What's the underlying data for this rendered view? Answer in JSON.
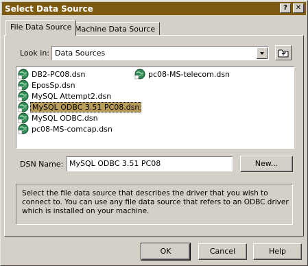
{
  "window": {
    "title": "Select Data Source",
    "help_glyph": "?",
    "close_glyph": "✕"
  },
  "tabs": [
    {
      "label": "File Data Source",
      "active": true
    },
    {
      "label": "Machine Data Source",
      "active": false
    }
  ],
  "look_in": {
    "label": "Look in:",
    "value": "Data Sources"
  },
  "files": [
    {
      "name": "DB2-PC08.dsn"
    },
    {
      "name": "EposSp.dsn"
    },
    {
      "name": "MySQL Attempt2.dsn"
    },
    {
      "name": "MySQL ODBC 3.51 PC08.dsn",
      "selected": true
    },
    {
      "name": "MySQL ODBC.dsn"
    },
    {
      "name": "pc08-MS-comcap.dsn"
    },
    {
      "name": "pc08-MS-telecom.dsn"
    }
  ],
  "dsn": {
    "label": "DSN Name:",
    "value": "MySQL ODBC 3.51 PC08",
    "new_button": "New..."
  },
  "info_text": "Select the file data source that describes the driver that you wish to connect to. You can use any file data source that refers to an ODBC driver which is installed on your machine.",
  "footer": {
    "ok": "OK",
    "cancel": "Cancel",
    "help": "Help"
  },
  "colors": {
    "titlebar": "#7f5a11",
    "selection": "#b89c5a",
    "face": "#d4d0c8"
  }
}
